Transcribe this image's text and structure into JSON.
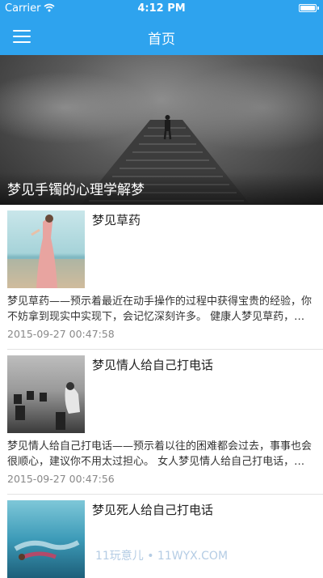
{
  "status_bar": {
    "carrier": "Carrier",
    "time": "4:12 PM"
  },
  "nav": {
    "title": "首页"
  },
  "hero": {
    "caption": "梦见手镯的心理学解梦"
  },
  "articles": [
    {
      "title": "梦见草药",
      "summary": "梦见草药——预示着最近在动手操作的过程中获得宝贵的经验，你不妨拿到现实中实现下，会记忆深刻许多。 健康人梦见草药，预示着你将会有好运。",
      "date": "2015-09-27 00:47:58"
    },
    {
      "title": "梦见情人给自己打电话",
      "summary": "梦见情人给自己打电话——预示着以往的困难都会过去，事事也会很顺心，建议你不用太过担心。 女人梦见情人给自己打电话，预示着你的感情会越来越好。",
      "date": "2015-09-27 00:47:56"
    },
    {
      "title": "梦见死人给自己打电话",
      "summary": "",
      "date": ""
    }
  ],
  "watermark": "11玩意儿 • 11WYX.COM",
  "colors": {
    "accent": "#2ea3ee"
  }
}
